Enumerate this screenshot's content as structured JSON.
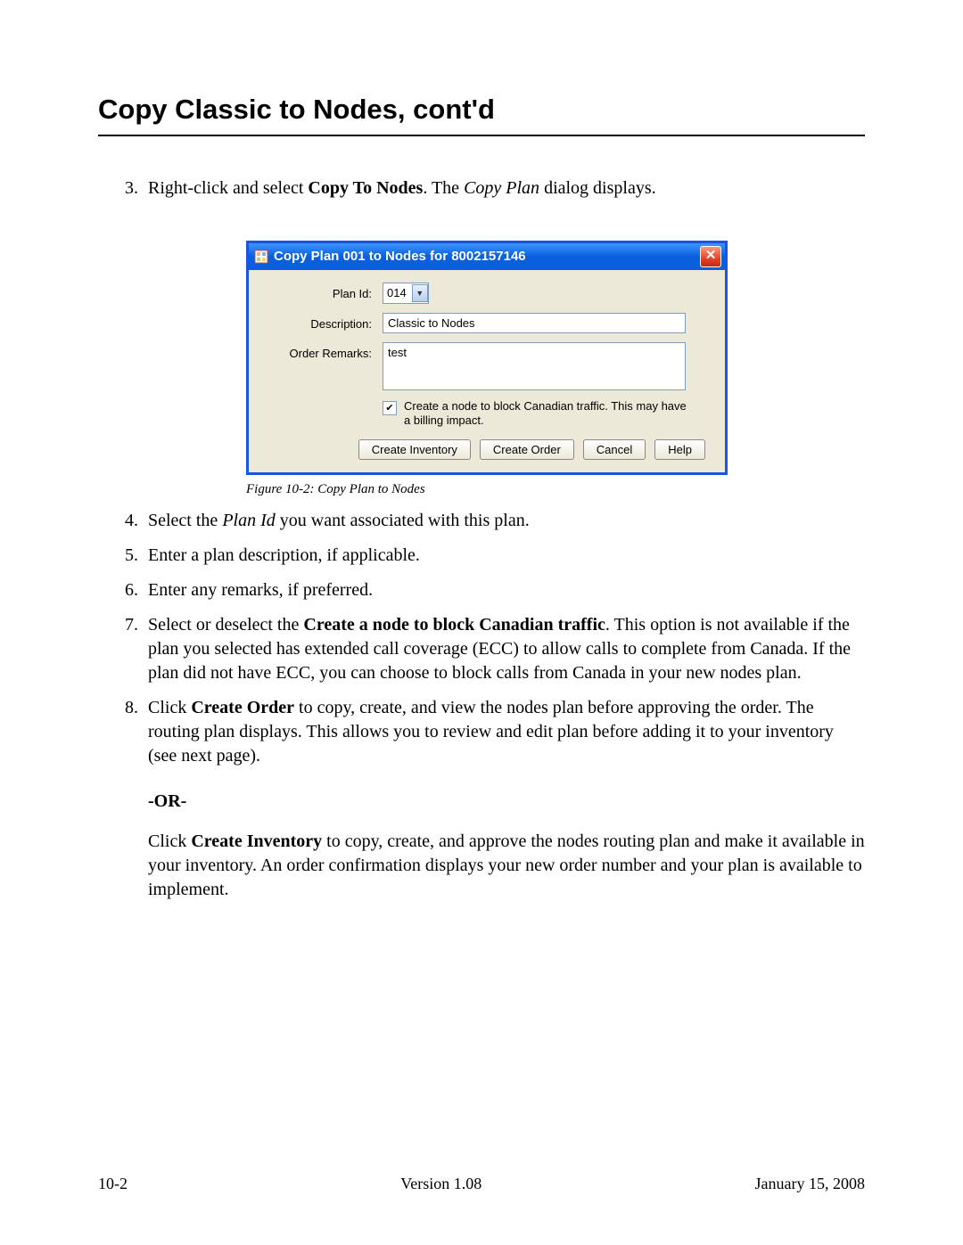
{
  "title": "Copy Classic to Nodes, cont'd",
  "steps": {
    "s3": {
      "prefix": "Right-click and select ",
      "bold": "Copy To Nodes",
      "mid": ". The ",
      "ital": "Copy Plan",
      "suffix": " dialog displays."
    },
    "s4": {
      "prefix": "Select the ",
      "ital": "Plan Id",
      "suffix": " you want associated with this plan."
    },
    "s5": "Enter a plan description, if applicable.",
    "s6": "Enter any remarks, if preferred.",
    "s7": {
      "prefix": "Select or deselect the ",
      "bold": "Create a node to block Canadian traffic",
      "suffix": ". This option is not available if the plan you selected has extended call coverage (ECC) to allow calls to complete from Canada. If the plan did not have ECC, you can choose to block calls from Canada in your new nodes plan."
    },
    "s8": {
      "prefix": "Click ",
      "bold": "Create Order",
      "suffix": " to copy, create, and view the nodes plan before approving the order. The routing plan displays. This allows you to review and edit plan before adding it to your inventory (see next page)."
    }
  },
  "or_label": "-OR-",
  "or_para": {
    "prefix": "Click ",
    "bold": "Create Inventory",
    "suffix": " to copy, create, and approve the nodes routing plan and make it available in your inventory. An order confirmation displays your new order number and your plan is available to implement."
  },
  "dialog": {
    "title": "Copy Plan 001 to Nodes for 8002157146",
    "labels": {
      "plan_id": "Plan Id:",
      "description": "Description:",
      "order_remarks": "Order Remarks:"
    },
    "values": {
      "plan_id": "014",
      "description": "Classic to Nodes",
      "order_remarks": "test"
    },
    "checkbox": {
      "checked": true,
      "label": "Create a node to block Canadian traffic. This may have a billing impact."
    },
    "buttons": {
      "create_inventory": "Create Inventory",
      "create_order": "Create Order",
      "cancel": "Cancel",
      "help": "Help"
    }
  },
  "figure_caption": "Figure 10-2:   Copy Plan to Nodes",
  "footer": {
    "left": "10-2",
    "center": "Version 1.08",
    "right": "January 15, 2008"
  }
}
